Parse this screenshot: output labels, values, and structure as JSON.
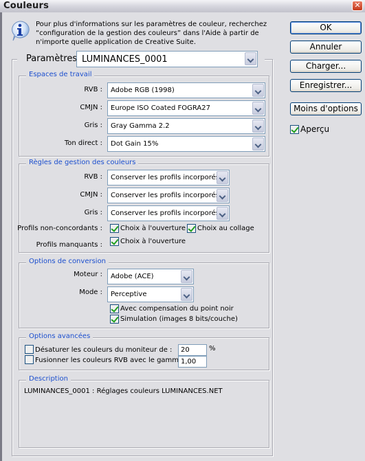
{
  "window": {
    "title": "Couleurs",
    "close_label": "✕"
  },
  "info": {
    "icon": "info-icon",
    "lines": [
      "Pour plus d'informations sur les paramètres de couleur, recherchez",
      "“configuration de la gestion des couleurs” dans l'Aide à partir de",
      "n'importe quelle application de Creative Suite."
    ]
  },
  "settings": {
    "label": "Paramètres :",
    "value": "LUMINANCES_0001"
  },
  "working_spaces": {
    "title": "Espaces de travail",
    "rows": [
      {
        "label": "RVB :",
        "value": "Adobe RGB (1998)"
      },
      {
        "label": "CMJN :",
        "value": "Europe ISO Coated FOGRA27"
      },
      {
        "label": "Gris :",
        "value": "Gray Gamma 2.2"
      },
      {
        "label": "Ton direct :",
        "value": "Dot Gain 15%"
      }
    ]
  },
  "policies": {
    "title": "Règles de gestion des couleurs",
    "rows": [
      {
        "label": "RVB :",
        "value": "Conserver les profils incorporés"
      },
      {
        "label": "CMJN :",
        "value": "Conserver les profils incorporés"
      },
      {
        "label": "Gris :",
        "value": "Conserver les profils incorporés"
      }
    ],
    "mismatch": {
      "label": "Profils non-concordants :",
      "ask_open": {
        "label": "Choix à l'ouverture",
        "checked": true
      },
      "ask_paste": {
        "label": "Choix au collage",
        "checked": true
      }
    },
    "missing": {
      "label": "Profils manquants :",
      "ask_open": {
        "label": "Choix à l'ouverture",
        "checked": true
      }
    }
  },
  "conversion": {
    "title": "Options de conversion",
    "engine": {
      "label": "Moteur :",
      "value": "Adobe (ACE)"
    },
    "intent": {
      "label": "Mode :",
      "value": "Perceptive"
    },
    "bpc": {
      "label": "Avec compensation du point noir",
      "checked": true
    },
    "dither": {
      "label": "Simulation (images 8 bits/couche)",
      "checked": true
    }
  },
  "advanced": {
    "title": "Options avancées",
    "desaturate": {
      "label": "Désaturer les couleurs du moniteur de :",
      "checked": false,
      "value": "20",
      "unit": "%"
    },
    "blend": {
      "label": "Fusionner les couleurs RVB avec le gamma :",
      "checked": false,
      "value": "1,00"
    }
  },
  "description": {
    "title": "Description",
    "text": "LUMINANCES_0001 :  Réglages couleurs LUMINANCES.NET"
  },
  "buttons": {
    "ok": "OK",
    "cancel": "Annuler",
    "load": "Charger...",
    "save": "Enregistrer...",
    "fewer_options": "Moins d'options"
  },
  "preview": {
    "label": "Aperçu",
    "checked": true
  },
  "colors": {
    "legend_blue": "#1c4fce",
    "check_green": "#21a121",
    "button_border": "#003c74"
  }
}
